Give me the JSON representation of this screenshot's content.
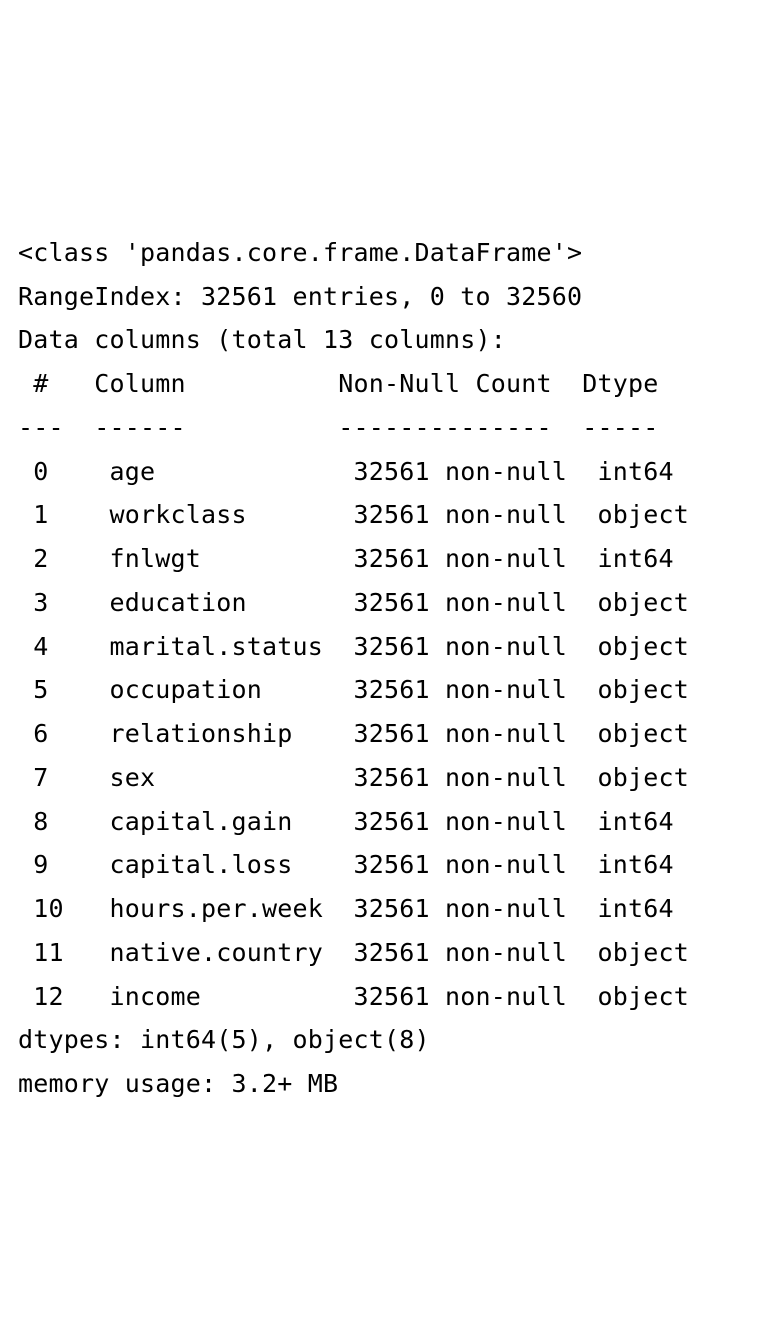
{
  "header": {
    "class_line": "<class 'pandas.core.frame.DataFrame'>",
    "range_index": "RangeIndex: 32561 entries, 0 to 32560",
    "data_columns": "Data columns (total 13 columns):"
  },
  "table_header": {
    "num": " #   Column          Non-Null Count  Dtype ",
    "sep": "---  ------          --------------  ----- "
  },
  "columns": [
    {
      "idx": "0",
      "name": "age",
      "nonnull": "32561 non-null",
      "dtype": "int64"
    },
    {
      "idx": "1",
      "name": "workclass",
      "nonnull": "32561 non-null",
      "dtype": "object"
    },
    {
      "idx": "2",
      "name": "fnlwgt",
      "nonnull": "32561 non-null",
      "dtype": "int64"
    },
    {
      "idx": "3",
      "name": "education",
      "nonnull": "32561 non-null",
      "dtype": "object"
    },
    {
      "idx": "4",
      "name": "marital.status",
      "nonnull": "32561 non-null",
      "dtype": "object"
    },
    {
      "idx": "5",
      "name": "occupation",
      "nonnull": "32561 non-null",
      "dtype": "object"
    },
    {
      "idx": "6",
      "name": "relationship",
      "nonnull": "32561 non-null",
      "dtype": "object"
    },
    {
      "idx": "7",
      "name": "sex",
      "nonnull": "32561 non-null",
      "dtype": "object"
    },
    {
      "idx": "8",
      "name": "capital.gain",
      "nonnull": "32561 non-null",
      "dtype": "int64"
    },
    {
      "idx": "9",
      "name": "capital.loss",
      "nonnull": "32561 non-null",
      "dtype": "int64"
    },
    {
      "idx": "10",
      "name": "hours.per.week",
      "nonnull": "32561 non-null",
      "dtype": "int64"
    },
    {
      "idx": "11",
      "name": "native.country",
      "nonnull": "32561 non-null",
      "dtype": "object"
    },
    {
      "idx": "12",
      "name": "income",
      "nonnull": "32561 non-null",
      "dtype": "object"
    }
  ],
  "footer": {
    "dtypes": "dtypes: int64(5), object(8)",
    "memory": "memory usage: 3.2+ MB"
  },
  "widths": {
    "idx": 3,
    "name": 14,
    "nonnull": 14,
    "sep_idx_name": 2,
    "sep_name_nn": 2,
    "sep_nn_dtype": 2
  }
}
